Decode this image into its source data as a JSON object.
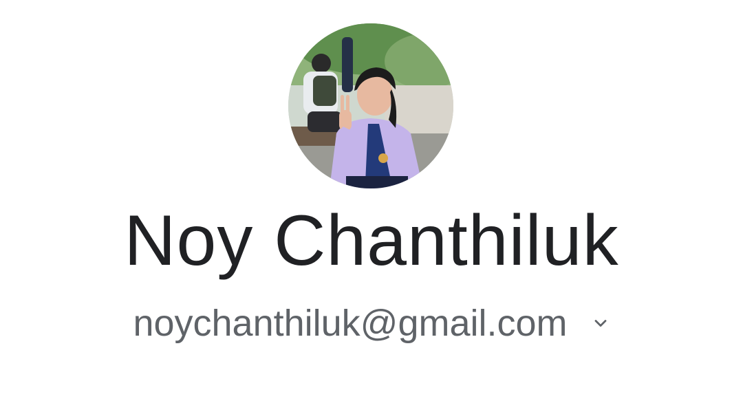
{
  "profile": {
    "avatar_icon": "profile-photo",
    "name": "Noy Chanthiluk",
    "email": "noychanthiluk@gmail.com",
    "account_switcher_icon": "chevron-down-icon"
  },
  "colors": {
    "background": "#ffffff",
    "name_text": "#202124",
    "email_text": "#5f6368"
  }
}
